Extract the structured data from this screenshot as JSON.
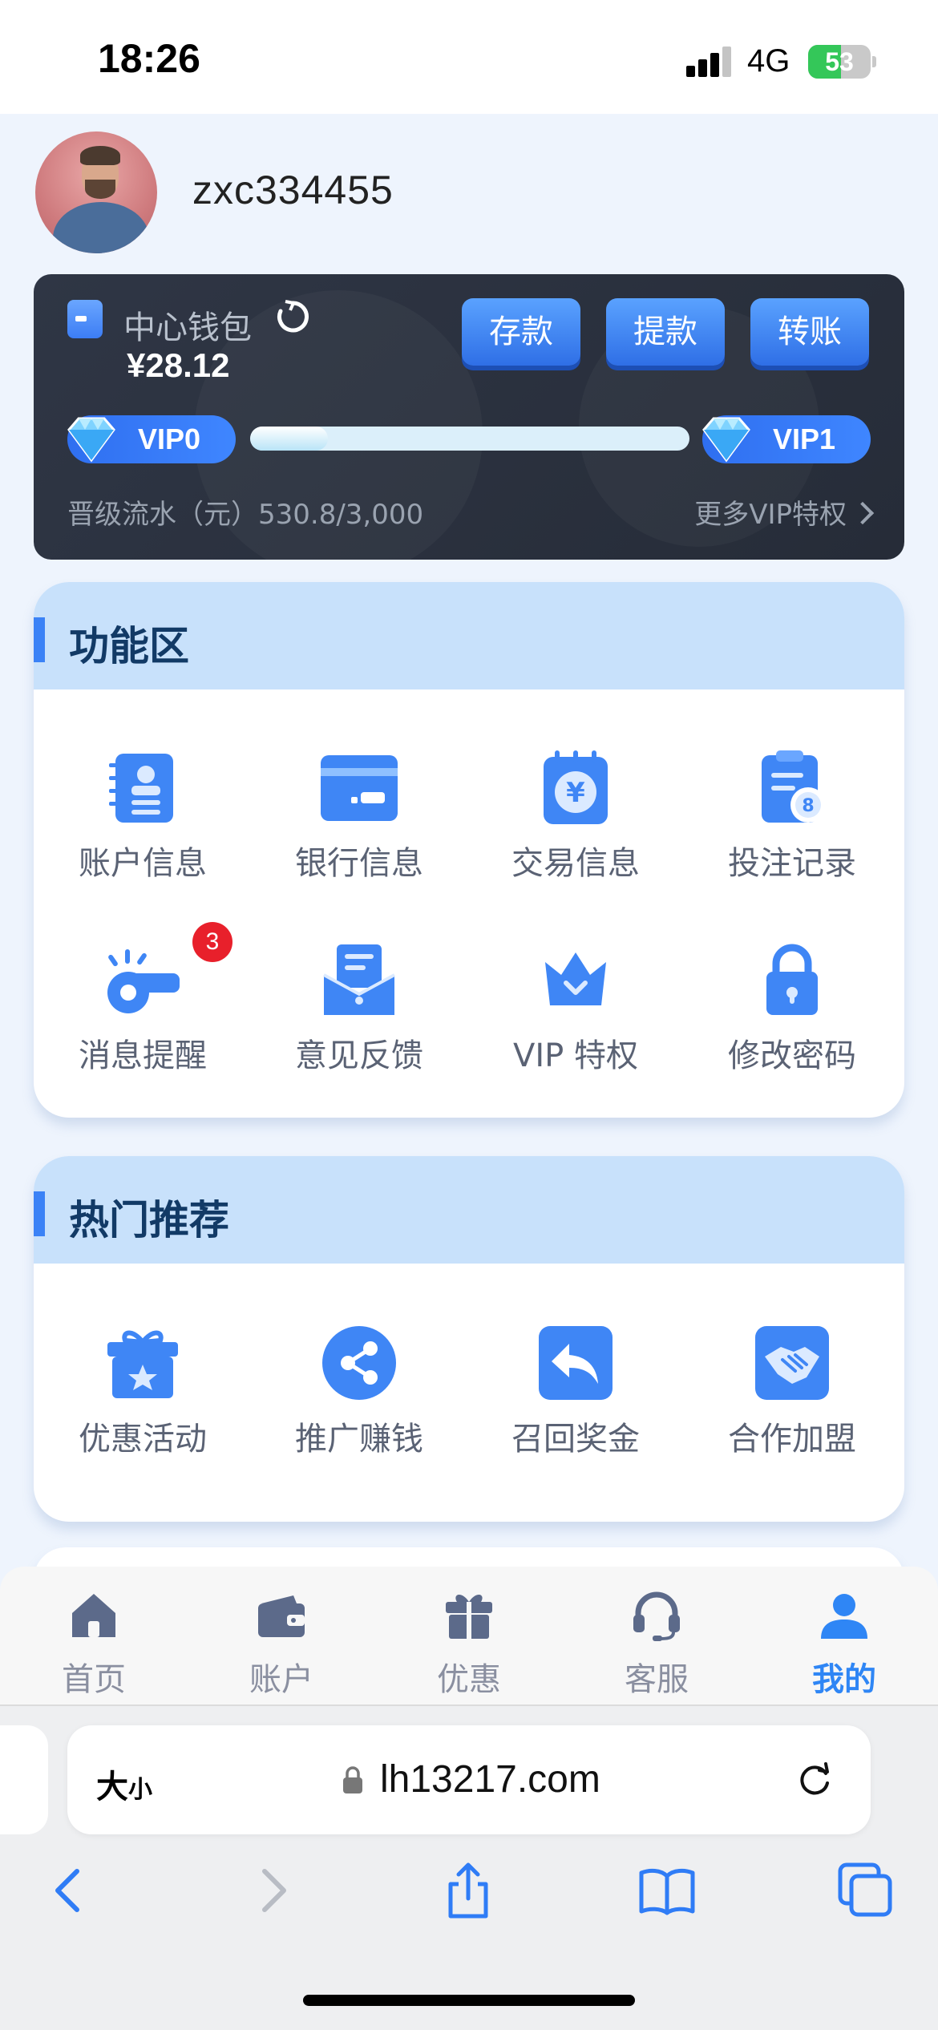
{
  "status_bar": {
    "time": "18:26",
    "network": "4G",
    "battery": "53",
    "battery_level": 0.53
  },
  "profile": {
    "username": "zxc334455"
  },
  "wallet": {
    "title": "中心钱包",
    "balance": "¥28.12",
    "buttons": {
      "deposit": "存款",
      "withdraw": "提款",
      "transfer": "转账"
    },
    "vip_current": "VIP0",
    "vip_next": "VIP1",
    "progress_fraction": 0.177,
    "progress_text": "晋级流水（元）530.8/3,000",
    "more_vip": "更多VIP特权"
  },
  "function_section": {
    "title": "功能区",
    "items": [
      {
        "label": "账户信息",
        "icon": "account-info-icon"
      },
      {
        "label": "银行信息",
        "icon": "bank-card-icon"
      },
      {
        "label": "交易信息",
        "icon": "transaction-icon"
      },
      {
        "label": "投注记录",
        "icon": "bet-record-icon"
      },
      {
        "label": "消息提醒",
        "icon": "whistle-icon",
        "badge": "3"
      },
      {
        "label": "意见反馈",
        "icon": "feedback-icon"
      },
      {
        "label": "VIP 特权",
        "icon": "crown-icon"
      },
      {
        "label": "修改密码",
        "icon": "lock-icon"
      }
    ]
  },
  "hot_section": {
    "title": "热门推荐",
    "items": [
      {
        "label": "优惠活动",
        "icon": "gift-box-icon"
      },
      {
        "label": "推广赚钱",
        "icon": "share-icon"
      },
      {
        "label": "召回奖金",
        "icon": "reply-icon"
      },
      {
        "label": "合作加盟",
        "icon": "handshake-icon"
      }
    ]
  },
  "tabbar": {
    "items": [
      {
        "label": "首页",
        "icon": "home-icon",
        "active": false
      },
      {
        "label": "账户",
        "icon": "wallet-icon",
        "active": false
      },
      {
        "label": "优惠",
        "icon": "gift-icon",
        "active": false
      },
      {
        "label": "客服",
        "icon": "headset-icon",
        "active": false
      },
      {
        "label": "我的",
        "icon": "user-icon",
        "active": true
      }
    ]
  },
  "safari": {
    "text_size_big": "大",
    "text_size_small": "小",
    "url": "lh13217.com"
  },
  "colors": {
    "accent": "#2f86f5",
    "wallet_bg": "#2b313e",
    "section_head": "#c8e1fb",
    "badge": "#e8202b"
  }
}
